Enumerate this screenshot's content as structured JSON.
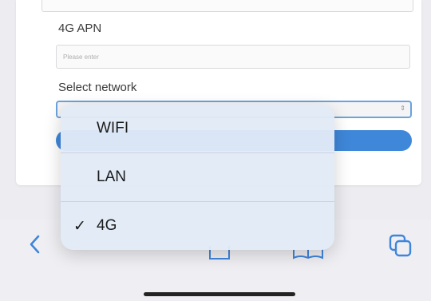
{
  "form": {
    "apn_label": "4G APN",
    "apn_placeholder": "Please enter",
    "network_label": "Select network"
  },
  "picker": {
    "options": [
      {
        "label": "WIFI",
        "selected": false
      },
      {
        "label": "LAN",
        "selected": false
      },
      {
        "label": "4G",
        "selected": true
      }
    ],
    "check_glyph": "✓"
  },
  "toolbar": {
    "icons": [
      "back-icon",
      "compose-icon",
      "share-icon",
      "bookmarks-icon",
      "tabs-icon"
    ]
  },
  "colors": {
    "accent": "#2f7dd6",
    "select_border": "#5f9cd8",
    "picker_bg": "#e1eaf6"
  }
}
